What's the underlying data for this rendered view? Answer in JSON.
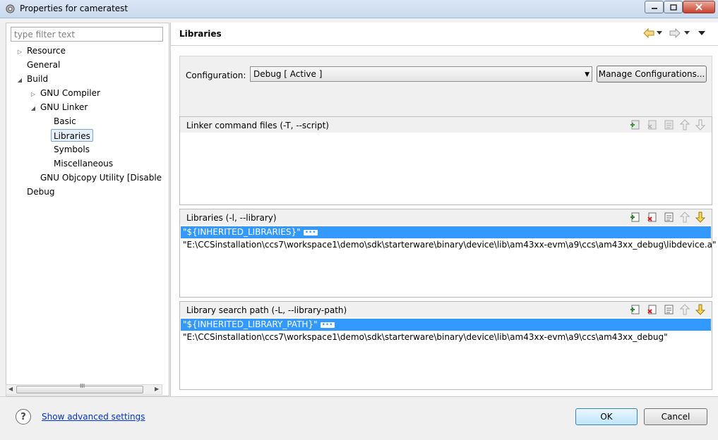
{
  "window": {
    "title": "Properties for cameratest",
    "minimize_icon": "minimize-icon",
    "maximize_icon": "maximize-icon",
    "close_icon": "close-icon"
  },
  "sidebar": {
    "filter_placeholder": "type filter text",
    "items": [
      {
        "label": "Resource",
        "expander": "collapsed"
      },
      {
        "label": "General",
        "expander": "none"
      },
      {
        "label": "Build",
        "expander": "expanded"
      },
      {
        "label": "GNU Compiler",
        "expander": "collapsed"
      },
      {
        "label": "GNU Linker",
        "expander": "expanded"
      },
      {
        "label": "Basic",
        "expander": "none"
      },
      {
        "label": "Libraries",
        "expander": "none",
        "selected": true
      },
      {
        "label": "Symbols",
        "expander": "none"
      },
      {
        "label": "Miscellaneous",
        "expander": "none"
      },
      {
        "label": "GNU Objcopy Utility  [Disable",
        "expander": "none"
      },
      {
        "label": "Debug",
        "expander": "none"
      }
    ],
    "scroll_grip": "III"
  },
  "main": {
    "page_title": "Libraries",
    "configuration": {
      "label": "Configuration:",
      "value": "Debug  [ Active ]",
      "manage_button": "Manage Configurations..."
    },
    "sections": [
      {
        "title": "Linker command files (-T, --script)",
        "rows": []
      },
      {
        "title": "Libraries (-l, --library)",
        "rows": [
          {
            "text": "\"${INHERITED_LIBRARIES}\"",
            "selected": true
          },
          {
            "text": "\"E:\\CCSinstallation\\ccs7\\workspace1\\demo\\sdk\\starterware\\binary\\device\\lib\\am43xx-evm\\a9\\ccs\\am43xx_debug\\libdevice.a\"",
            "selected": false
          }
        ]
      },
      {
        "title": "Library search path (-L, --library-path)",
        "rows": [
          {
            "text": "\"${INHERITED_LIBRARY_PATH}\"",
            "selected": true
          },
          {
            "text": "\"E:\\CCSinstallation\\ccs7\\workspace1\\demo\\sdk\\starterware\\binary\\device\\lib\\am43xx-evm\\a9\\ccs\\am43xx_debug\"",
            "selected": false
          }
        ]
      }
    ],
    "ellipsis": "•••"
  },
  "footer": {
    "help": "?",
    "advanced_link": "Show advanced settings",
    "ok": "OK",
    "cancel": "Cancel"
  },
  "colors": {
    "selection": "#3399ff",
    "link": "#0033cc"
  }
}
